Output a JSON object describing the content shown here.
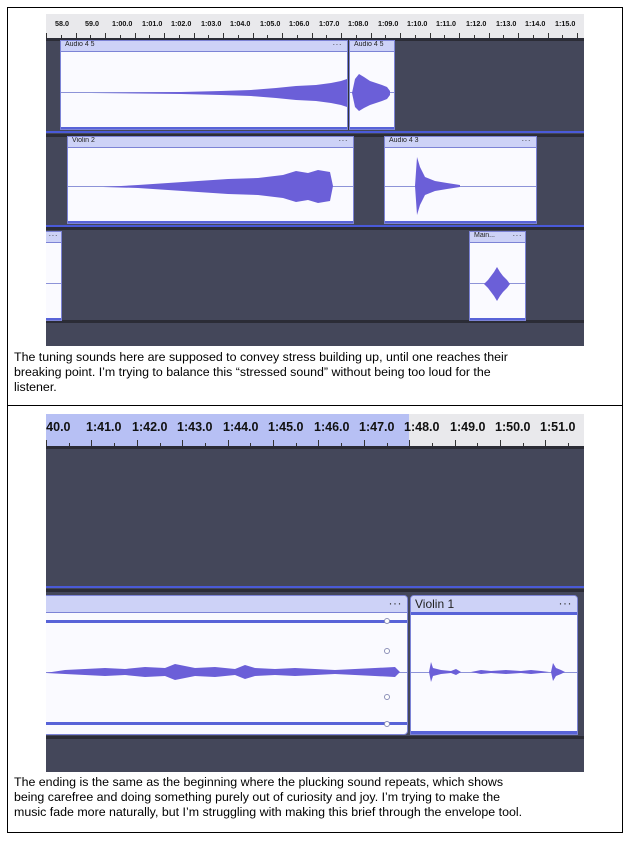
{
  "screenshot1": {
    "ruler_labels": [
      "58.0",
      "59.0",
      "1:00.0",
      "1:01.0",
      "1:02.0",
      "1:03.0",
      "1:04.0",
      "1:05.0",
      "1:06.0",
      "1:07.0",
      "1:08.0",
      "1:09.0",
      "1:10.0",
      "1:11.0",
      "1:12.0",
      "1:13.0",
      "1:14.0",
      "1:15.0"
    ],
    "clips": [
      {
        "name": "Audio 4 5",
        "menu": "···"
      },
      {
        "name": "Audio 4 5",
        "menu": ""
      },
      {
        "name": "Violin 2",
        "menu": "···"
      },
      {
        "name": "Audio 4 3",
        "menu": "···"
      },
      {
        "name": "",
        "menu": "···"
      },
      {
        "name": "Main...",
        "menu": "···"
      }
    ]
  },
  "caption1": [
    "The tuning sounds here are supposed to convey stress building up, until one reaches their",
    "breaking point. I’m trying to balance this “stressed sound” without being too loud for the",
    "listener."
  ],
  "screenshot2": {
    "ruler_labels": [
      ":40.0",
      "1:41.0",
      "1:42.0",
      "1:43.0",
      "1:44.0",
      "1:45.0",
      "1:46.0",
      "1:47.0",
      "1:48.0",
      "1:49.0",
      "1:50.0",
      "1:51.0"
    ],
    "clips": [
      {
        "name": "",
        "menu": "···"
      },
      {
        "name": "Violin 1",
        "menu": "···"
      }
    ]
  },
  "caption2": [
    "The ending is the same as the beginning where the plucking sound repeats, which shows",
    "being carefree and doing something purely out of curiosity and joy. I’m trying to make the",
    "music fade more naturally, but I’m struggling with making this brief through the envelope tool."
  ],
  "colors": {
    "waveform": "#6b5fd8",
    "track_bg": "#44475a",
    "clip_bg": "#fafaff",
    "clip_header": "#cdd2f7",
    "selection": "#b7c0f4"
  }
}
